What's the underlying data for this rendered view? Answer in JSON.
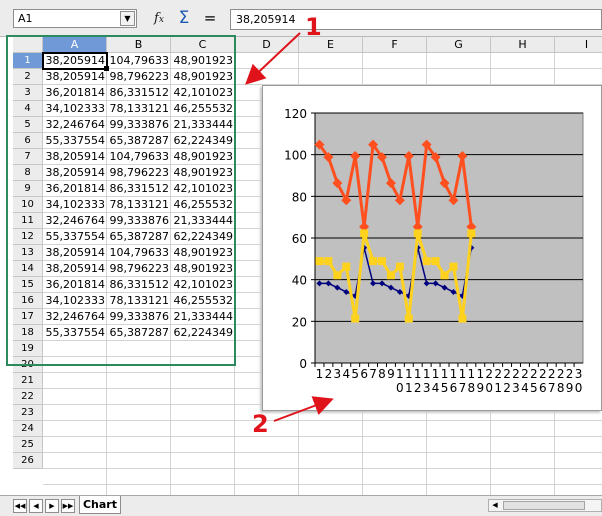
{
  "formula_bar": {
    "name_box": "A1",
    "fx_icon": "function-wizard-icon",
    "sum_icon": "sum-icon",
    "equals_label": "=",
    "formula_value": "38,205914"
  },
  "columns": [
    "A",
    "B",
    "C",
    "D",
    "E",
    "F",
    "G",
    "H",
    "I"
  ],
  "rows": [
    "1",
    "2",
    "3",
    "4",
    "5",
    "6",
    "7",
    "8",
    "9",
    "10",
    "11",
    "12",
    "13",
    "14",
    "15",
    "16",
    "17",
    "18",
    "19",
    "20",
    "21",
    "22",
    "23",
    "24",
    "25",
    "26"
  ],
  "cells": [
    [
      "38,205914",
      "104,79633",
      "48,901923"
    ],
    [
      "38,205914",
      "98,796223",
      "48,901923"
    ],
    [
      "36,201814",
      "86,331512",
      "42,101023"
    ],
    [
      "34,102333",
      "78,133121",
      "46,255532"
    ],
    [
      "32,246764",
      "99,333876",
      "21,333444"
    ],
    [
      "55,337554",
      "65,387287",
      "62,224349"
    ],
    [
      "38,205914",
      "104,79633",
      "48,901923"
    ],
    [
      "38,205914",
      "98,796223",
      "48,901923"
    ],
    [
      "36,201814",
      "86,331512",
      "42,101023"
    ],
    [
      "34,102333",
      "78,133121",
      "46,255532"
    ],
    [
      "32,246764",
      "99,333876",
      "21,333444"
    ],
    [
      "55,337554",
      "65,387287",
      "62,224349"
    ],
    [
      "38,205914",
      "104,79633",
      "48,901923"
    ],
    [
      "38,205914",
      "98,796223",
      "48,901923"
    ],
    [
      "36,201814",
      "86,331512",
      "42,101023"
    ],
    [
      "34,102333",
      "78,133121",
      "46,255532"
    ],
    [
      "32,246764",
      "99,333876",
      "21,333444"
    ],
    [
      "55,337554",
      "65,387287",
      "62,224349"
    ]
  ],
  "annotations": {
    "one": "1",
    "two": "2"
  },
  "sheet_tabs": [
    "Chart"
  ],
  "colors": {
    "series_a": "#00007f",
    "series_b": "#ff4f1e",
    "series_c": "#ffd21e",
    "plot_bg": "#c0c0c0",
    "annotation": "#e0131a",
    "selection_border": "#2c8a5e"
  },
  "chart_data": {
    "type": "line",
    "ylim": [
      0,
      120
    ],
    "yticks": [
      0,
      20,
      40,
      60,
      80,
      100,
      120
    ],
    "grid": true,
    "x": [
      "1",
      "2",
      "3",
      "4",
      "5",
      "6",
      "7",
      "8",
      "9",
      "10",
      "11",
      "12",
      "13",
      "14",
      "15",
      "16",
      "17",
      "18",
      "19",
      "20",
      "21",
      "22",
      "23",
      "24",
      "25",
      "26",
      "27",
      "28",
      "29",
      "30"
    ],
    "xtick_line1": [
      "1",
      "2",
      "3",
      "4",
      "5",
      "6",
      "7",
      "8",
      "9",
      "1",
      "1",
      "1",
      "1",
      "1",
      "1",
      "1",
      "1",
      "1",
      "1",
      "2",
      "2",
      "2",
      "2",
      "2",
      "2",
      "2",
      "2",
      "2",
      "2",
      "3"
    ],
    "xtick_line2": [
      "",
      "",
      "",
      "",
      "",
      "",
      "",
      "",
      "",
      "0",
      "1",
      "2",
      "3",
      "4",
      "5",
      "6",
      "7",
      "8",
      "9",
      "0",
      "1",
      "2",
      "3",
      "4",
      "5",
      "6",
      "7",
      "8",
      "9",
      "0"
    ],
    "series": [
      {
        "values": [
          38.205914,
          38.205914,
          36.201814,
          34.102333,
          32.246764,
          55.337554,
          38.205914,
          38.205914,
          36.201814,
          34.102333,
          32.246764,
          55.337554,
          38.205914,
          38.205914,
          36.201814,
          34.102333,
          32.246764,
          55.337554
        ]
      },
      {
        "values": [
          104.79633,
          98.796223,
          86.331512,
          78.133121,
          99.333876,
          65.387287,
          104.79633,
          98.796223,
          86.331512,
          78.133121,
          99.333876,
          65.387287,
          104.79633,
          98.796223,
          86.331512,
          78.133121,
          99.333876,
          65.387287
        ]
      },
      {
        "values": [
          48.901923,
          48.901923,
          42.101023,
          46.255532,
          21.333444,
          62.224349,
          48.901923,
          48.901923,
          42.101023,
          46.255532,
          21.333444,
          62.224349,
          48.901923,
          48.901923,
          42.101023,
          46.255532,
          21.333444,
          62.224349
        ]
      }
    ]
  }
}
